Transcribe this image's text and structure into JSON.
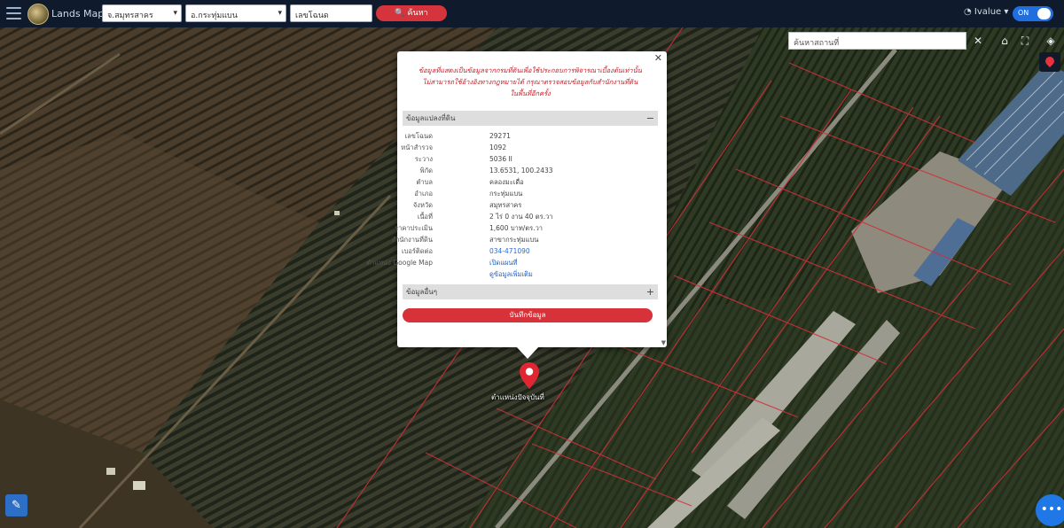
{
  "app": {
    "brand": "Lands Maps",
    "province_select": "จ.สมุทรสาคร",
    "district_select": "อ.กระทุ่มแบน",
    "parcel_input": "เลขโฉนด",
    "search_button": "🔍 ค้นหา",
    "user_name": "Ivalue",
    "toggle_label": "ON"
  },
  "map": {
    "search_placeholder": "ค้นหาสถานที่",
    "marker_label": "ตำแหน่งปัจจุบันที่",
    "colors": {
      "parcel_line": "#d0303a",
      "pin": "#e02633"
    }
  },
  "popup": {
    "warning_lines": [
      "ข้อมูลที่แสดงเป็นข้อมูลจากกรมที่ดินเพื่อใช้ประกอบการพิจารณาเบื้องต้นเท่านั้น",
      "ไม่สามารถใช้อ้างอิงทางกฎหมายได้ กรุณาตรวจสอบข้อมูลกับสำนักงานที่ดิน",
      "ในพื้นที่อีกครั้ง"
    ],
    "section_parcel": "ข้อมูลแปลงที่ดิน",
    "rows": [
      {
        "key": "เลขโฉนด",
        "value": "29271"
      },
      {
        "key": "หน้าสำรวจ",
        "value": "1092"
      },
      {
        "key": "ระวาง",
        "value": "5036 II"
      },
      {
        "key": "พิกัด",
        "value": "13.6531, 100.2433"
      },
      {
        "key": "ตำบล",
        "value": "คลองมะเดื่อ"
      },
      {
        "key": "อำเภอ",
        "value": "กระทุ่มแบน"
      },
      {
        "key": "จังหวัด",
        "value": "สมุทรสาคร"
      },
      {
        "key": "เนื้อที่",
        "value": "2 ไร่ 0 งาน 40 ตร.วา"
      },
      {
        "key": "ราคาประเมิน",
        "value": "1,600 บาท/ตร.วา"
      },
      {
        "key": "สำนักงานที่ดิน",
        "value": "สาขากระทุ่มแบน"
      },
      {
        "key": "เบอร์ติดต่อ",
        "value": "034-471090"
      },
      {
        "key": "ตำแหน่ง Google Map",
        "value": "เปิดแผนที่"
      },
      {
        "key": "",
        "value": "ดูข้อมูลเพิ่มเติม"
      }
    ],
    "section_other": "ข้อมูลอื่นๆ",
    "action_button": "บันทึกข้อมูล"
  }
}
